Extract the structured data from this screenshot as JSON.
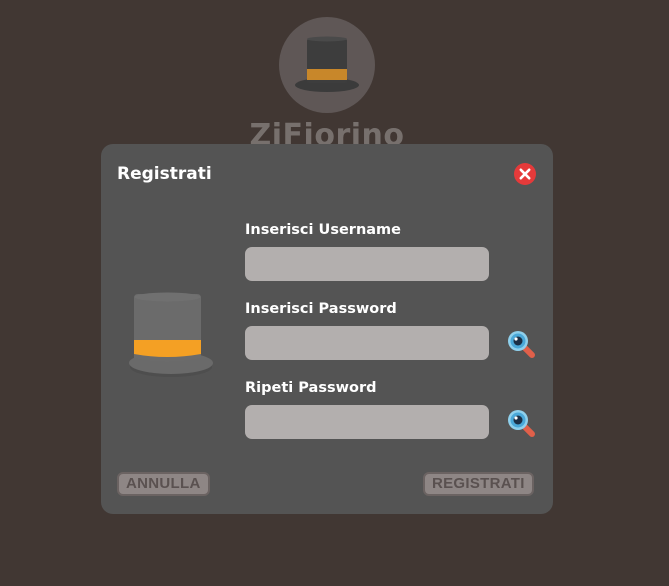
{
  "background": {
    "app_name": "ZiFiorino",
    "logo_icon": "top-hat-icon"
  },
  "dialog": {
    "title": "Registrati",
    "close_icon": "close-icon",
    "illustration_icon": "top-hat-icon",
    "fields": [
      {
        "label": "Inserisci Username",
        "value": "",
        "placeholder": ""
      },
      {
        "label": "Inserisci Password",
        "value": "",
        "placeholder": "",
        "toggle_icon": "eye-icon"
      },
      {
        "label": "Ripeti Password",
        "value": "",
        "placeholder": "",
        "toggle_icon": "eye-icon"
      }
    ],
    "cancel_label": "ANNULLA",
    "register_label": "REGISTRATI"
  },
  "colors": {
    "background": "#413733",
    "dialog": "#545454",
    "input": "#b3afae",
    "close": "#e53a3a",
    "hat_band": "#f5a52e",
    "button": "#8e8685"
  }
}
